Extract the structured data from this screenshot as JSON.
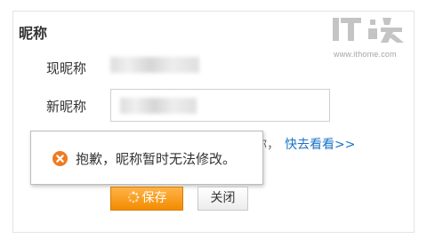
{
  "section": {
    "title": "昵称"
  },
  "form": {
    "current_label": "现昵称",
    "new_label": "新昵称"
  },
  "hint": {
    "partial_text": "你，",
    "link_text": "快去看看>>"
  },
  "popup": {
    "icon": "error-icon",
    "message": "抱歉，昵称暂时无法修改。"
  },
  "buttons": {
    "save_label": "保存",
    "close_label": "关闭"
  },
  "watermark": {
    "logo_text": "IT之家",
    "url": "www.ithome.com"
  },
  "colors": {
    "accent_orange": "#f28c00",
    "link_blue": "#1a73c7",
    "error_icon": "#f07b1f"
  }
}
